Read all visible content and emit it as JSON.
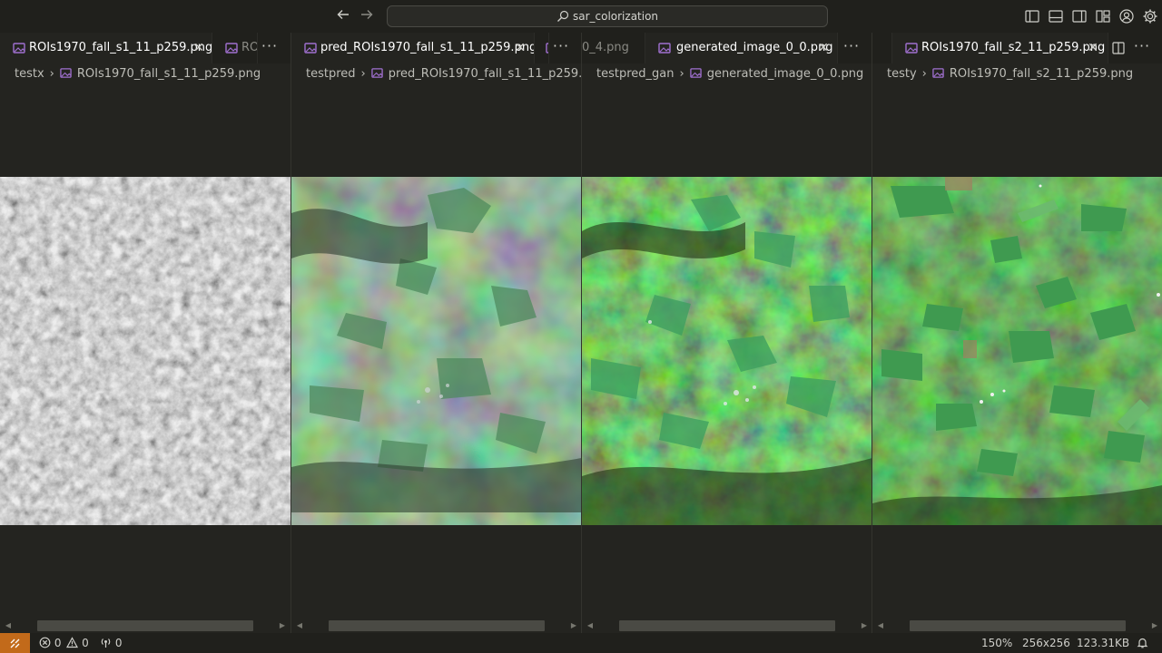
{
  "titlebar": {
    "search_text": "sar_colorization",
    "back_icon": "arrow-left-icon",
    "forward_icon": "arrow-right-icon"
  },
  "groups": [
    {
      "tabs": [
        {
          "label": "ROIs1970_fall_s1_11_p259.png",
          "active": true
        },
        {
          "label": "RO",
          "active": false
        }
      ],
      "breadcrumb": {
        "folder": "testx",
        "file": "ROIs1970_fall_s1_11_p259.png"
      },
      "image_kind": "sar-grayscale"
    },
    {
      "tabs": [
        {
          "label": "pred_ROIs1970_fall_s1_11_p259.png",
          "active": true
        },
        {
          "label": "",
          "active": false
        }
      ],
      "breadcrumb": {
        "folder": "testpred",
        "file": "pred_ROIs1970_fall_s1_11_p259.png"
      },
      "image_kind": "pred-colorized"
    },
    {
      "tabs": [
        {
          "label": "0_4.png",
          "active": false
        },
        {
          "label": "generated_image_0_0.png",
          "active": true
        }
      ],
      "breadcrumb": {
        "folder": "testpred_gan",
        "file": "generated_image_0_0.png"
      },
      "image_kind": "gan-colorized"
    },
    {
      "tabs": [
        {
          "label": "ROIs1970_fall_s2_11_p259.png",
          "active": true
        }
      ],
      "breadcrumb": {
        "folder": "testy",
        "file": "ROIs1970_fall_s2_11_p259.png"
      },
      "image_kind": "optical-ground-truth"
    }
  ],
  "statusbar": {
    "errors": "0",
    "warnings": "0",
    "ports": "0",
    "zoom": "150%",
    "dimensions": "256x256",
    "filesize": "123.31KB"
  },
  "colors": {
    "titlebar_bg": "#20201c",
    "editor_bg": "#242420",
    "remote_accent": "#c26a1a",
    "image_file_icon": "#a070d0"
  }
}
